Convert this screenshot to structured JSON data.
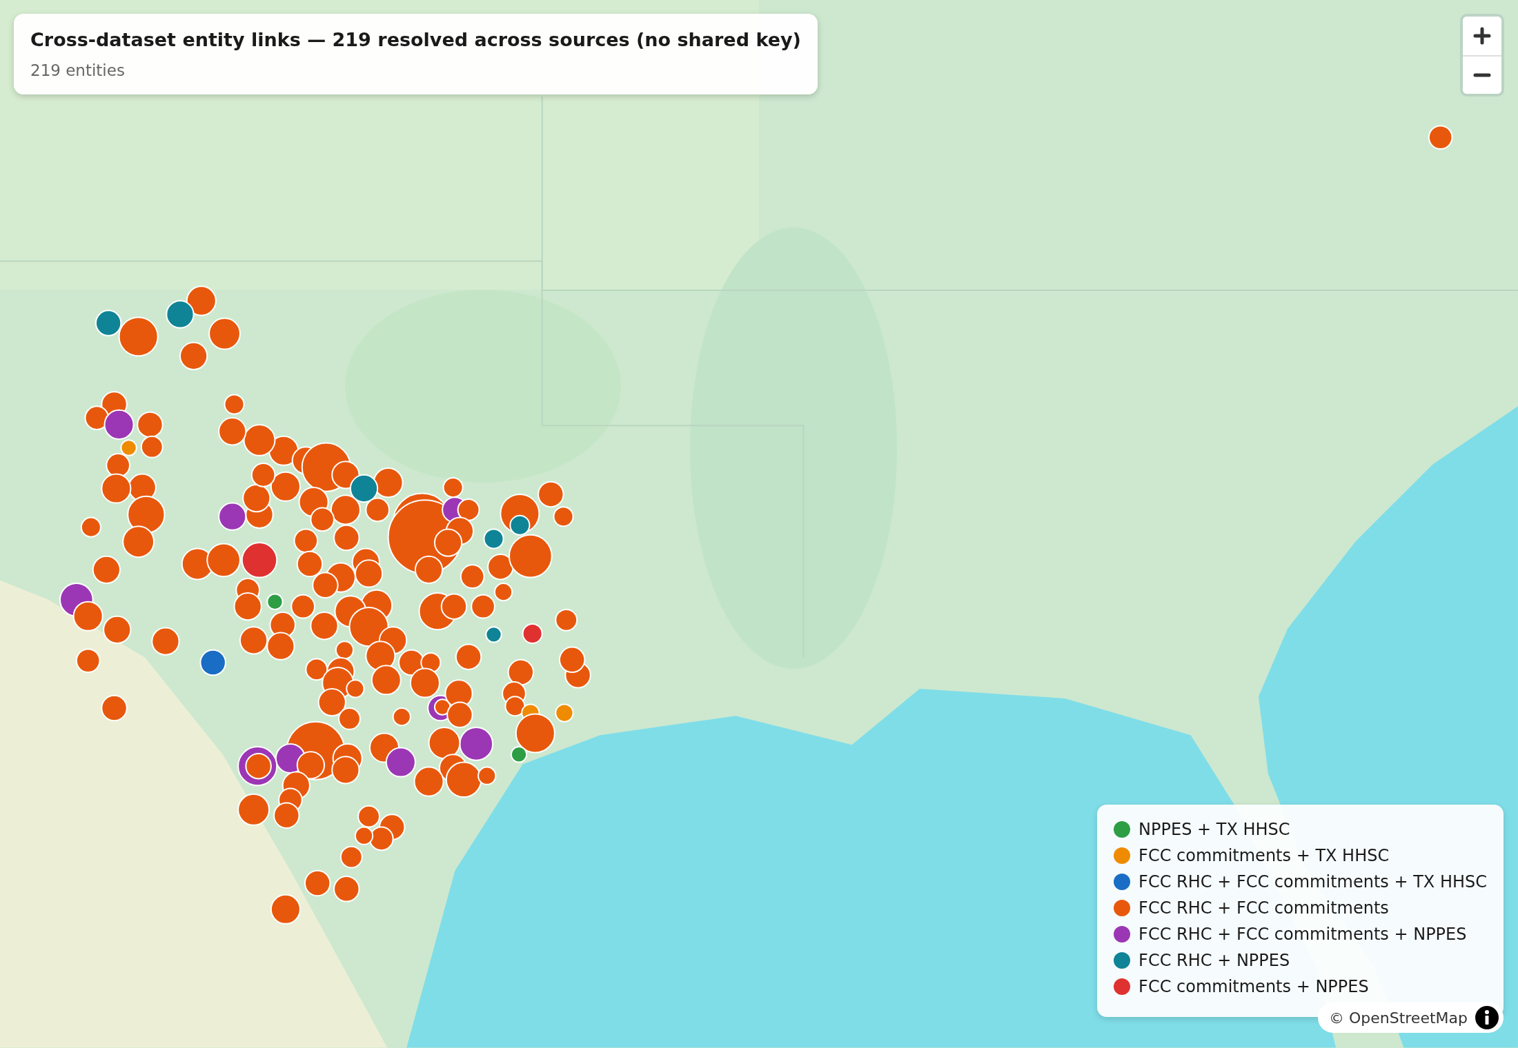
{
  "header": {
    "title": "Cross-dataset entity links — 219 resolved across sources (no shared key)",
    "subtitle": "219 entities"
  },
  "legend": {
    "items": [
      {
        "label": "NPPES + TX HHSC",
        "color": "#2e9e44"
      },
      {
        "label": "FCC commitments + TX HHSC",
        "color": "#ef8b00"
      },
      {
        "label": "FCC RHC + FCC commitments + TX HHSC",
        "color": "#1a6dc4"
      },
      {
        "label": "FCC RHC + FCC commitments",
        "color": "#e8580c"
      },
      {
        "label": "FCC RHC + FCC commitments + NPPES",
        "color": "#9b37b5"
      },
      {
        "label": "FCC RHC + NPPES",
        "color": "#0f8496"
      },
      {
        "label": "FCC commitments + NPPES",
        "color": "#e03131"
      }
    ]
  },
  "attribution": "© OpenStreetMap"
}
